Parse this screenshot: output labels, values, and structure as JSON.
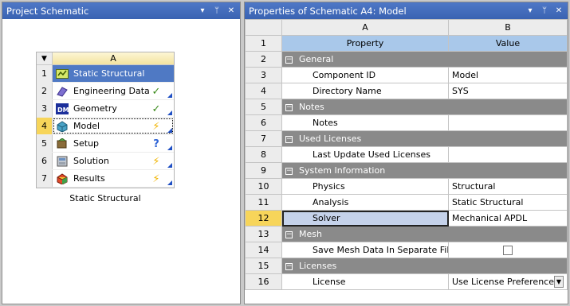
{
  "left_pane": {
    "title": "Project Schematic",
    "controls": {
      "dropdown": "▾",
      "pin": "ᛘ",
      "close": "✕"
    }
  },
  "system": {
    "column_letter": "A",
    "menu_glyph": "▼",
    "caption": "Static Structural",
    "rows": [
      {
        "num": "1",
        "label": "Static Structural",
        "icon": "static-structural-icon",
        "state": ""
      },
      {
        "num": "2",
        "label": "Engineering Data",
        "icon": "engineering-data-icon",
        "state": "✓"
      },
      {
        "num": "3",
        "label": "Geometry",
        "icon": "geometry-dm-icon",
        "state": "✓"
      },
      {
        "num": "4",
        "label": "Model",
        "icon": "model-icon",
        "state": "⚡"
      },
      {
        "num": "5",
        "label": "Setup",
        "icon": "setup-icon",
        "state": "?"
      },
      {
        "num": "6",
        "label": "Solution",
        "icon": "solution-icon",
        "state": "⚡"
      },
      {
        "num": "7",
        "label": "Results",
        "icon": "results-icon",
        "state": "⚡"
      }
    ]
  },
  "right_pane": {
    "title": "Properties of Schematic A4: Model",
    "controls": {
      "dropdown": "▾",
      "pin": "ᛘ",
      "close": "✕"
    },
    "col_letters": [
      "A",
      "B"
    ],
    "col_names": [
      "Property",
      "Value"
    ],
    "rows": [
      {
        "num": "2",
        "type": "group",
        "label": "General"
      },
      {
        "num": "3",
        "type": "item",
        "label": "Component ID",
        "value": "Model"
      },
      {
        "num": "4",
        "type": "item",
        "label": "Directory Name",
        "value": "SYS"
      },
      {
        "num": "5",
        "type": "group",
        "label": "Notes"
      },
      {
        "num": "6",
        "type": "item",
        "label": "Notes",
        "value": ""
      },
      {
        "num": "7",
        "type": "group",
        "label": "Used Licenses"
      },
      {
        "num": "8",
        "type": "item",
        "label": "Last Update Used Licenses",
        "value": ""
      },
      {
        "num": "9",
        "type": "group",
        "label": "System Information"
      },
      {
        "num": "10",
        "type": "item",
        "label": "Physics",
        "value": "Structural"
      },
      {
        "num": "11",
        "type": "item",
        "label": "Analysis",
        "value": "Static Structural"
      },
      {
        "num": "12",
        "type": "item",
        "label": "Solver",
        "value": "Mechanical APDL"
      },
      {
        "num": "13",
        "type": "group",
        "label": "Mesh"
      },
      {
        "num": "14",
        "type": "item",
        "label": "Save Mesh Data In Separate File",
        "value": ""
      },
      {
        "num": "15",
        "type": "group",
        "label": "Licenses"
      },
      {
        "num": "16",
        "type": "item",
        "label": "License",
        "value": "Use License Preference"
      }
    ]
  }
}
